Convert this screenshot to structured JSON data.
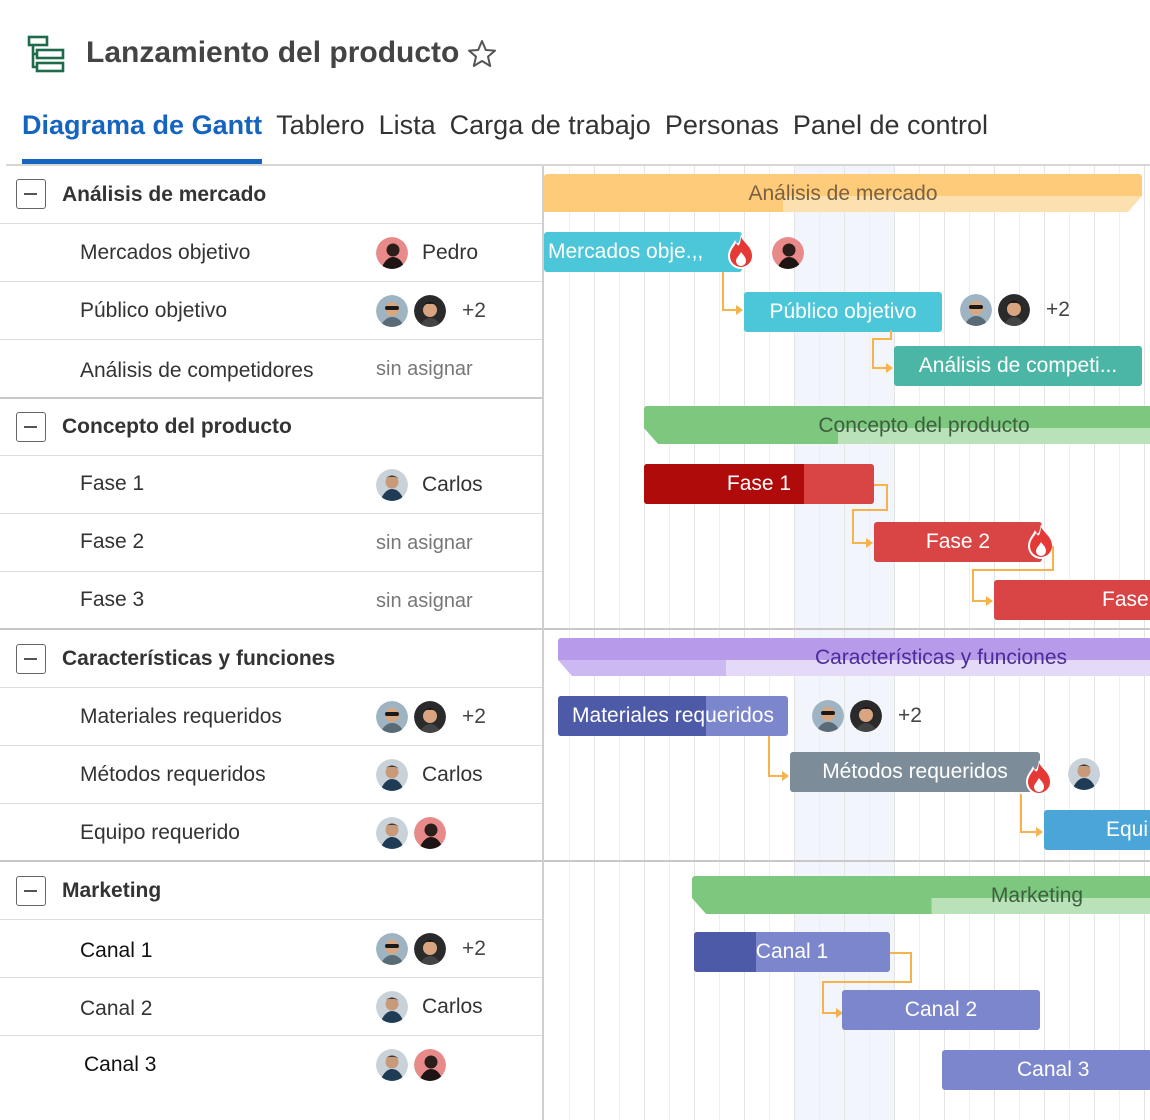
{
  "header": {
    "title": "Lanzamiento del producto",
    "icon": "gantt-app-icon",
    "favorite_icon": "star-outline-icon"
  },
  "tabs": [
    {
      "label": "Diagrama de Gantt",
      "active": true
    },
    {
      "label": "Tablero",
      "active": false
    },
    {
      "label": "Lista",
      "active": false
    },
    {
      "label": "Carga de trabajo",
      "active": false
    },
    {
      "label": "Personas",
      "active": false
    },
    {
      "label": "Panel de control",
      "active": false
    }
  ],
  "groups": [
    {
      "name": "Análisis de mercado",
      "tasks": [
        {
          "name": "Mercados objetivo",
          "assignee": "Pedro"
        },
        {
          "name": "Público objetivo",
          "assignee_more": "+2"
        },
        {
          "name": "Análisis de competidores",
          "assignee": "sin asignar"
        }
      ]
    },
    {
      "name": "Concepto del producto",
      "tasks": [
        {
          "name": "Fase 1",
          "assignee": "Carlos"
        },
        {
          "name": "Fase 2",
          "assignee": "sin asignar"
        },
        {
          "name": "Fase 3",
          "assignee": "sin asignar"
        }
      ]
    },
    {
      "name": "Características y funciones",
      "tasks": [
        {
          "name": "Materiales requeridos",
          "assignee_more": "+2"
        },
        {
          "name": "Métodos requeridos",
          "assignee": "Carlos"
        },
        {
          "name": "Equipo requerido",
          "assignee": ""
        }
      ]
    },
    {
      "name": "Marketing",
      "tasks": [
        {
          "name": "Canal 1",
          "assignee_more": "+2"
        },
        {
          "name": "Canal 2",
          "assignee": "Carlos"
        },
        {
          "name": "Canal 3",
          "assignee": ""
        }
      ]
    }
  ],
  "bars": {
    "g1": "Análisis de mercado",
    "t1": "Mercados obje.,,",
    "t2": "Público objetivo",
    "t3": "Análisis de competi...",
    "g2": "Concepto del producto",
    "t4": "Fase 1",
    "t5": "Fase 2",
    "t6": "Fase",
    "g3": "Características y funciones",
    "t7": "Materiales requeridos",
    "t8": "Métodos requeridos",
    "t9": "Equi",
    "g4": "Marketing",
    "t10": "Canal 1",
    "t11": "Canal 2",
    "t12": "Canal 3",
    "more_a": "+2",
    "more_b": "+2"
  },
  "colors": {
    "accent": "#1565c0",
    "market": "#fecb7a",
    "concept": "#7dc87f",
    "features": "#b79ae9",
    "marketing": "#7dc87f",
    "cyan": "#4cc7da",
    "teal": "#4cb6a6",
    "red_dark": "#b00b0b",
    "red": "#d94444",
    "indigo": "#4d5aa8",
    "slate": "#7c8c99",
    "blue": "#4aa6d8",
    "periwinkle": "#7c86cc",
    "connector": "#f6b24b",
    "fire": "#e53935"
  }
}
